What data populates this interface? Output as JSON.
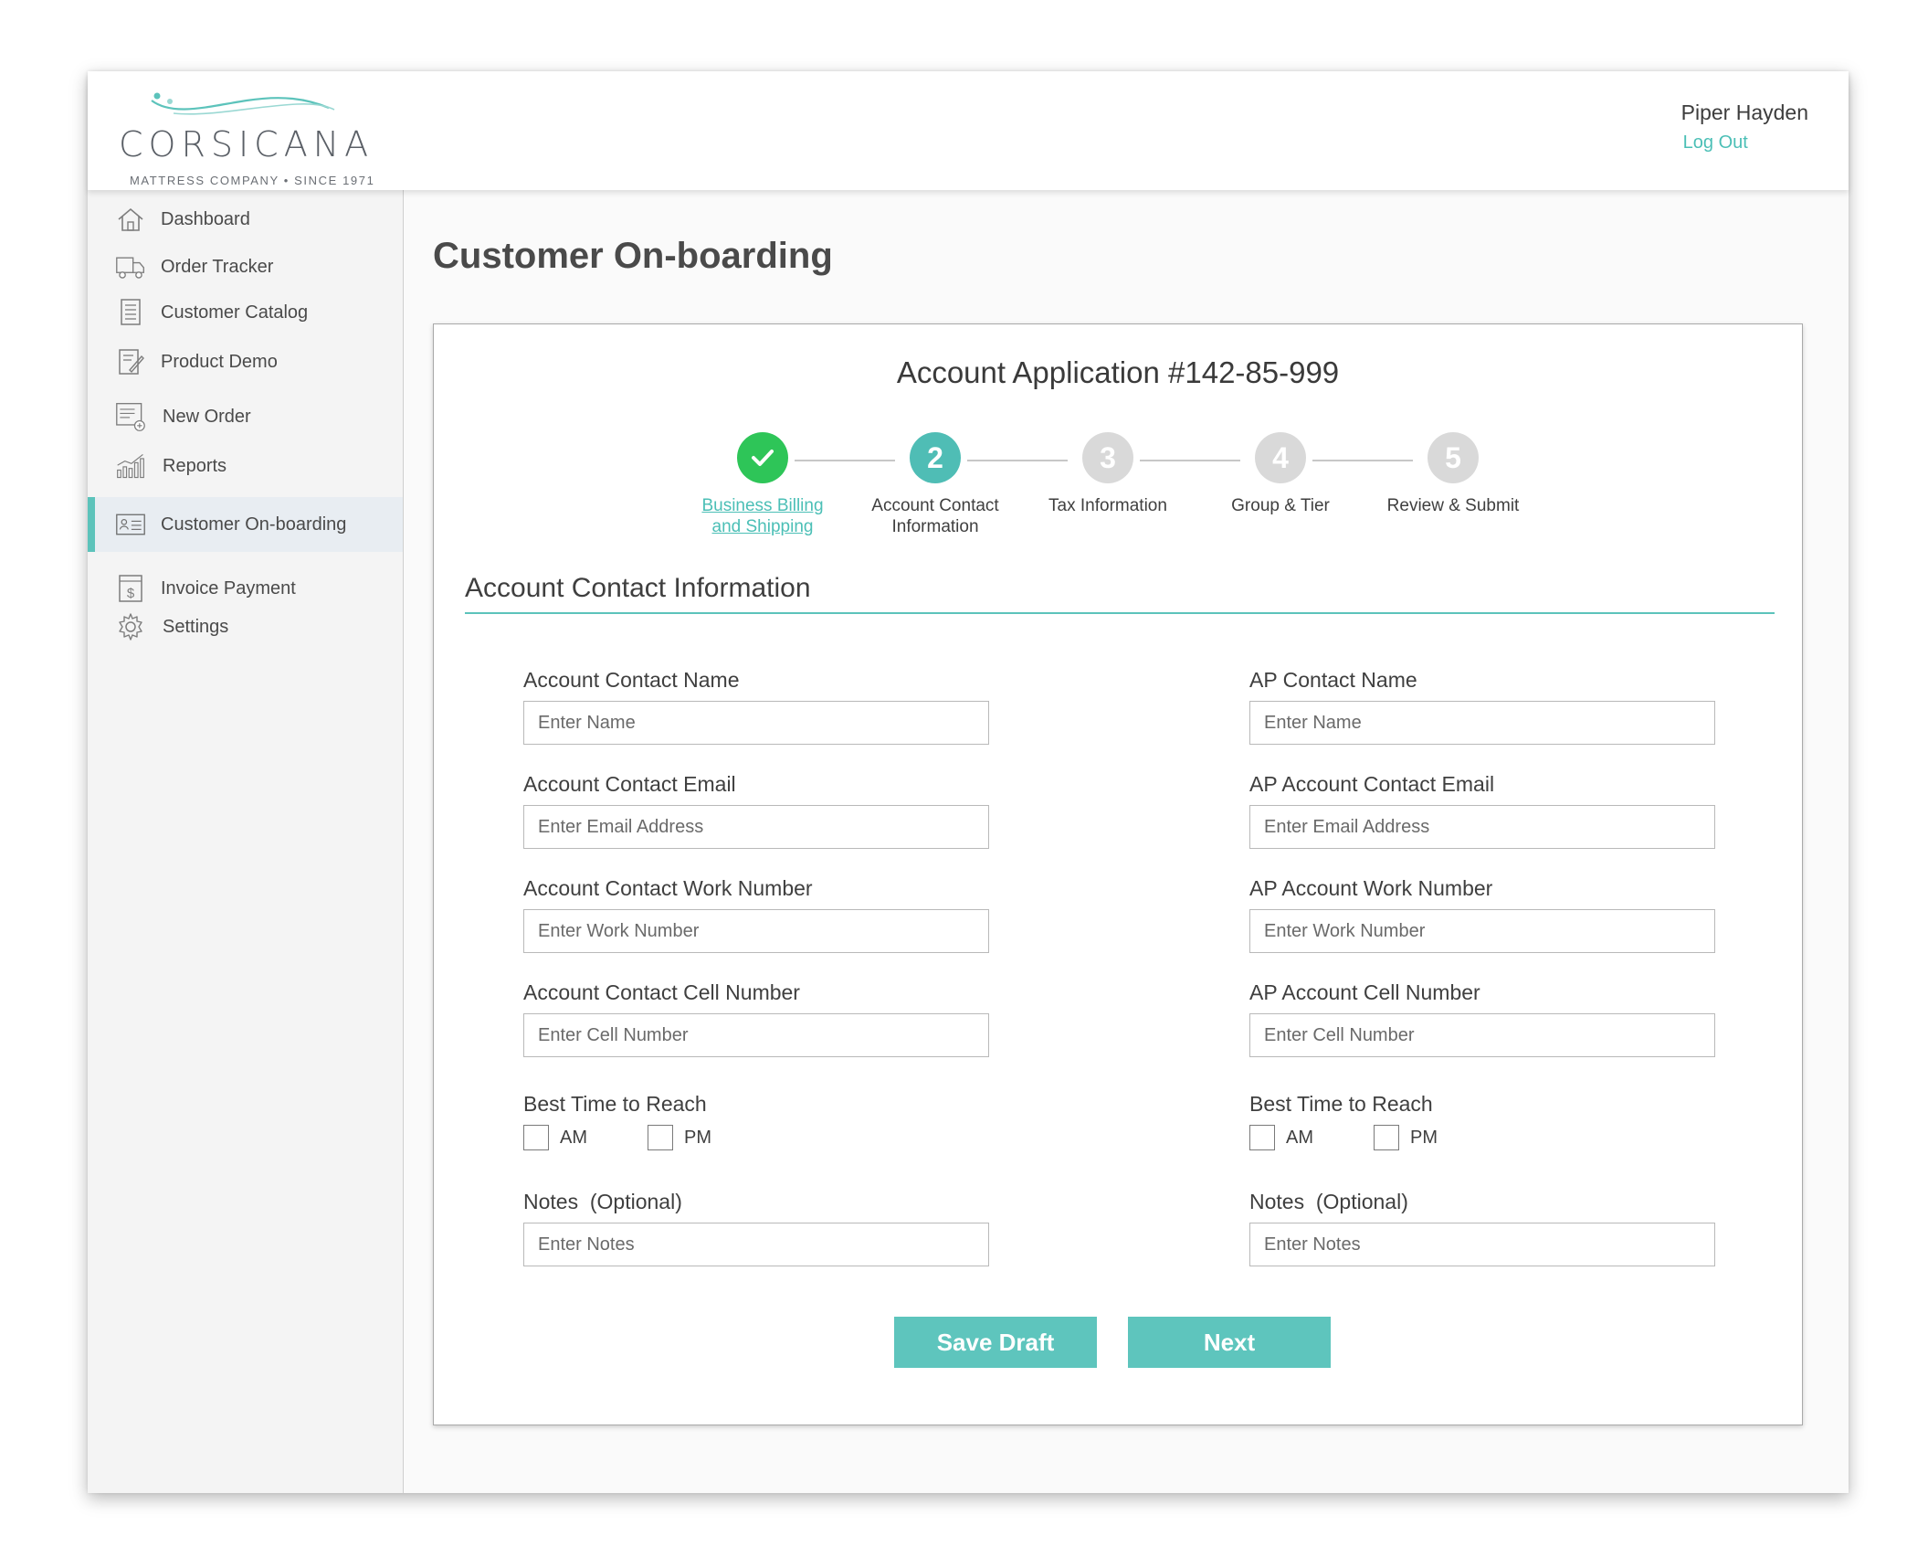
{
  "brand": {
    "name": "CORSICANA",
    "tagline": "MATTRESS COMPANY • SINCE 1971",
    "accent": "#5cc3bb",
    "success": "#2ec558"
  },
  "header": {
    "user_name": "Piper Hayden",
    "logout_label": "Log Out"
  },
  "sidebar": {
    "items": [
      {
        "label": "Dashboard",
        "icon": "home-icon"
      },
      {
        "label": "Order Tracker",
        "icon": "truck-icon"
      },
      {
        "label": "Customer Catalog",
        "icon": "catalog-icon"
      },
      {
        "label": "Product Demo",
        "icon": "demo-icon"
      },
      {
        "label": "New Order",
        "icon": "new-order-icon"
      },
      {
        "label": "Reports",
        "icon": "reports-icon"
      },
      {
        "label": "Customer On-boarding",
        "icon": "id-card-icon",
        "active": true
      },
      {
        "label": "Invoice Payment",
        "icon": "invoice-icon"
      },
      {
        "label": "Settings",
        "icon": "gear-icon"
      }
    ]
  },
  "page": {
    "title": "Customer On-boarding"
  },
  "application": {
    "title": "Account Application #142-85-999",
    "steps": [
      {
        "number": "1",
        "label_line1": "Business Billing",
        "label_line2": "and Shipping",
        "state": "done"
      },
      {
        "number": "2",
        "label_line1": "Account Contact",
        "label_line2": "Information",
        "state": "current"
      },
      {
        "number": "3",
        "label_line1": "Tax Information",
        "label_line2": "",
        "state": "pending"
      },
      {
        "number": "4",
        "label_line1": "Group & Tier",
        "label_line2": "",
        "state": "pending"
      },
      {
        "number": "5",
        "label_line1": "Review & Submit",
        "label_line2": "",
        "state": "pending"
      }
    ],
    "section_title": "Account Contact Information"
  },
  "form": {
    "left": {
      "name_label": "Account Contact Name",
      "name_placeholder": "Enter Name",
      "email_label": "Account Contact Email",
      "email_placeholder": "Enter Email Address",
      "work_label": "Account Contact Work Number",
      "work_placeholder": "Enter Work Number",
      "cell_label": "Account Contact Cell Number",
      "cell_placeholder": "Enter Cell Number",
      "time_label": "Best Time to Reach",
      "am_label": "AM",
      "pm_label": "PM",
      "notes_label": "Notes  (Optional)",
      "notes_placeholder": "Enter Notes"
    },
    "right": {
      "name_label": "AP Contact Name",
      "name_placeholder": "Enter Name",
      "email_label": "AP Account Contact Email",
      "email_placeholder": "Enter Email Address",
      "work_label": "AP Account Work Number",
      "work_placeholder": "Enter Work Number",
      "cell_label": "AP Account Cell Number",
      "cell_placeholder": "Enter Cell Number",
      "time_label": "Best Time to Reach",
      "am_label": "AM",
      "pm_label": "PM",
      "notes_label": "Notes  (Optional)",
      "notes_placeholder": "Enter Notes"
    }
  },
  "actions": {
    "save_draft_label": "Save Draft",
    "next_label": "Next"
  }
}
